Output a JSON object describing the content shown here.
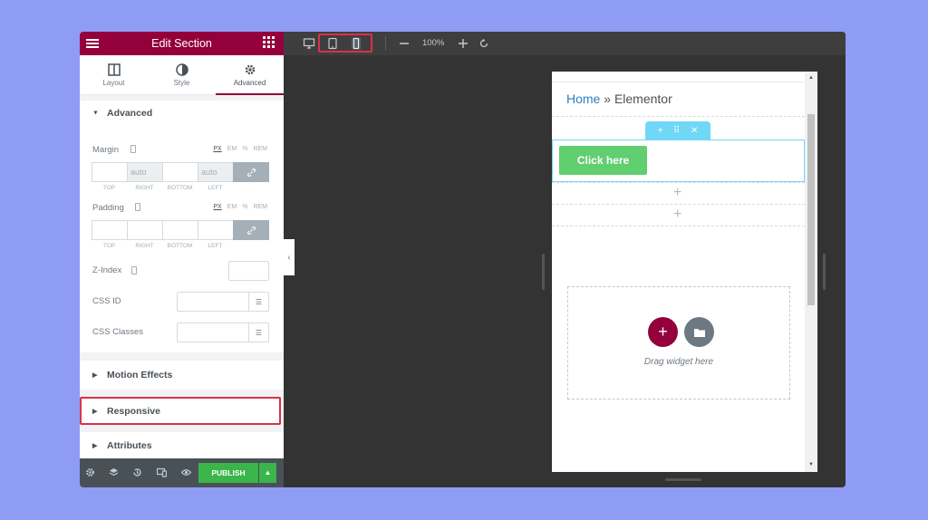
{
  "panel": {
    "title": "Edit Section",
    "tabs": [
      {
        "label": "Layout",
        "icon": "columns-icon"
      },
      {
        "label": "Style",
        "icon": "contrast-icon"
      },
      {
        "label": "Advanced",
        "icon": "gear-icon",
        "active": true
      }
    ],
    "sections": {
      "advanced": "Advanced",
      "motion_effects": "Motion Effects",
      "responsive": "Responsive",
      "attributes": "Attributes"
    },
    "margin": {
      "label": "Margin",
      "units": [
        "PX",
        "EM",
        "%",
        "REM"
      ],
      "values": [
        "",
        "auto",
        "",
        "auto"
      ],
      "sides": [
        "TOP",
        "RIGHT",
        "BOTTOM",
        "LEFT"
      ]
    },
    "padding": {
      "label": "Padding",
      "units": [
        "PX",
        "EM",
        "%",
        "REM"
      ],
      "values": [
        "",
        "",
        "",
        ""
      ],
      "sides": [
        "TOP",
        "RIGHT",
        "BOTTOM",
        "LEFT"
      ]
    },
    "z_index_label": "Z-Index",
    "css_id_label": "CSS ID",
    "css_classes_label": "CSS Classes",
    "publish_label": "PUBLISH"
  },
  "topbar": {
    "zoom": "100%"
  },
  "preview": {
    "breadcrumb_home": "Home",
    "breadcrumb_sep": " » ",
    "breadcrumb_current": "Elementor",
    "button_label": "Click here",
    "drag_text": "Drag widget here"
  },
  "colors": {
    "brand": "#93003c",
    "highlight": "#d93248",
    "publish": "#39b54a",
    "button": "#61ce70",
    "selection": "#71d7f7"
  }
}
